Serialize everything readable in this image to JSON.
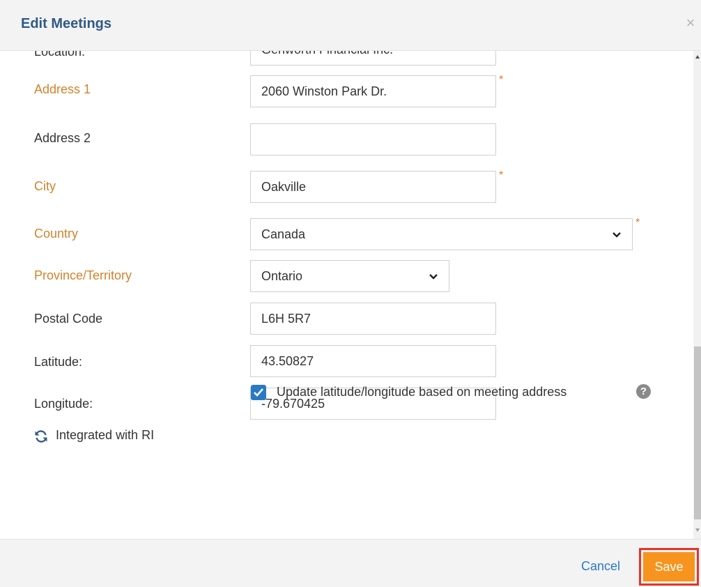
{
  "dialog": {
    "title": "Edit Meetings",
    "close_symbol": "×"
  },
  "form": {
    "location": {
      "label": "Location:",
      "value": "Genworth Financial Inc."
    },
    "address1": {
      "label": "Address 1",
      "value": "2060 Winston Park Dr.",
      "required": true
    },
    "address2": {
      "label": "Address 2",
      "value": ""
    },
    "city": {
      "label": "City",
      "value": "Oakville",
      "required": true
    },
    "country": {
      "label": "Country",
      "value": "Canada",
      "required": true
    },
    "province": {
      "label": "Province/Territory",
      "value": "Ontario"
    },
    "postal_code": {
      "label": "Postal Code",
      "value": "L6H 5R7"
    },
    "latitude": {
      "label": "Latitude:",
      "value": "43.50827"
    },
    "longitude": {
      "label": "Longitude:",
      "value": "-79.670425"
    },
    "update_latlong": {
      "label": "Update latitude/longitude based on meeting address",
      "checked": true
    },
    "help_symbol": "?",
    "required_marker": "*",
    "integration": {
      "label": "Integrated with RI"
    }
  },
  "footer": {
    "cancel_label": "Cancel",
    "save_label": "Save"
  },
  "colors": {
    "required_label": "#d2832b",
    "title": "#2f5a86",
    "save_button": "#f7941d",
    "link": "#2a79c4",
    "highlight": "#e8322b"
  }
}
